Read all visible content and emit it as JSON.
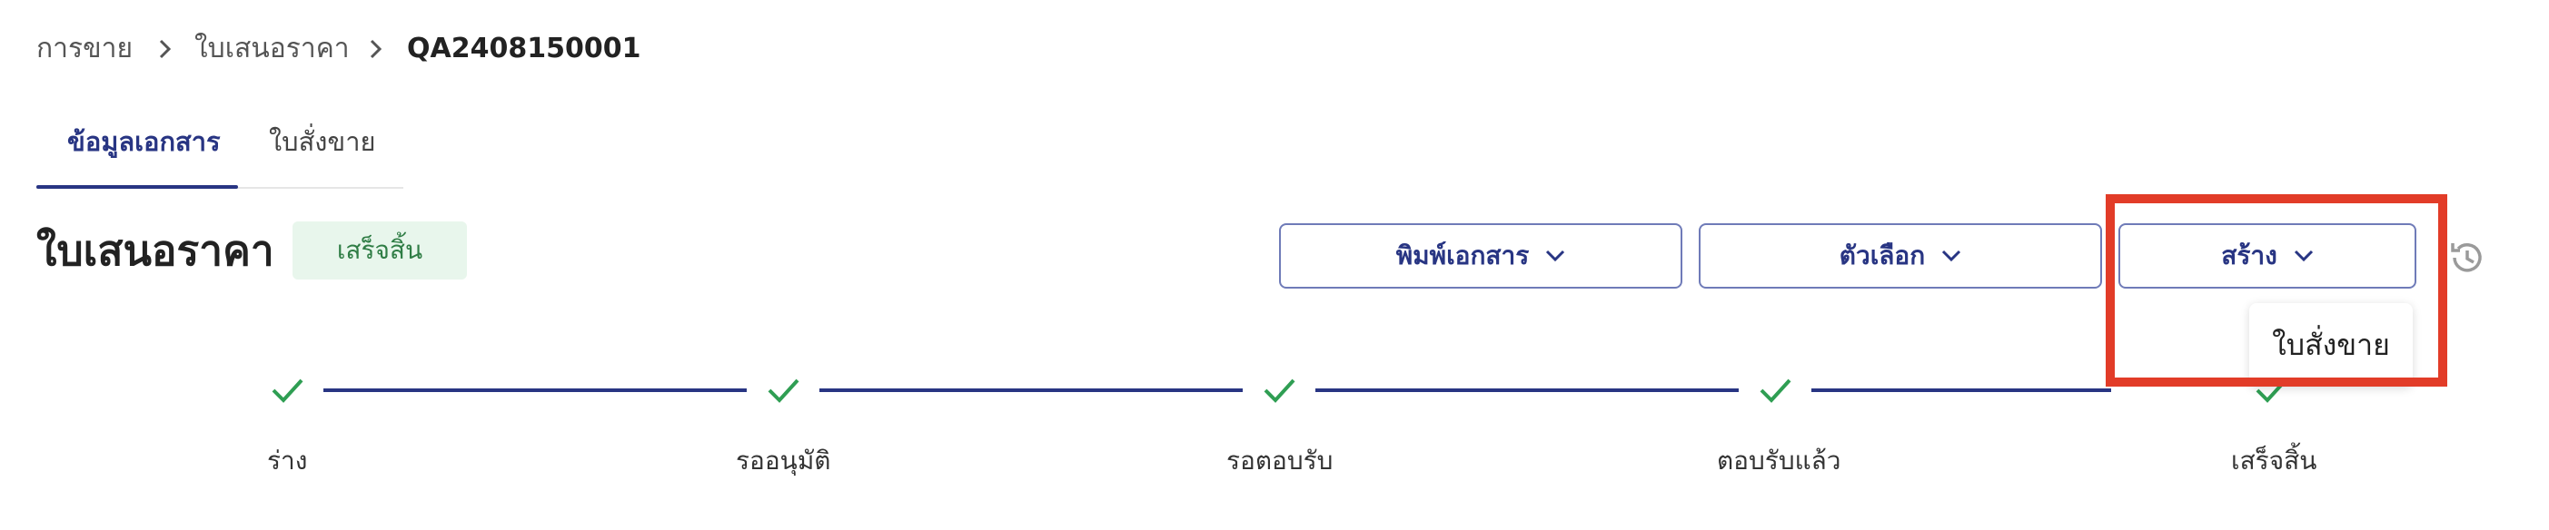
{
  "breadcrumb": {
    "items": [
      "การขาย",
      "ใบเสนอราคา",
      "QA2408150001"
    ]
  },
  "tabs": [
    {
      "label": "ข้อมูลเอกสาร",
      "active": true
    },
    {
      "label": "ใบสั่งขาย",
      "active": false
    }
  ],
  "header": {
    "title": "ใบเสนอราคา",
    "status_badge": "เสร็จสิ้น"
  },
  "toolbar": {
    "print_label": "พิมพ์เอกสาร",
    "options_label": "ตัวเลือก",
    "create_label": "สร้าง",
    "history_icon": "history-icon"
  },
  "create_menu": {
    "items": [
      "ใบสั่งขาย"
    ]
  },
  "progress": {
    "steps": [
      {
        "label": "ร่าง",
        "done": true
      },
      {
        "label": "รออนุมัติ",
        "done": true
      },
      {
        "label": "รอตอบรับ",
        "done": true
      },
      {
        "label": "ตอบรับแล้ว",
        "done": true
      },
      {
        "label": "เสร็จสิ้น",
        "done": true
      }
    ]
  },
  "colors": {
    "primary": "#283583",
    "success": "#2f9e53",
    "badge_bg": "#e8f6ec",
    "highlight": "#e23c28"
  }
}
